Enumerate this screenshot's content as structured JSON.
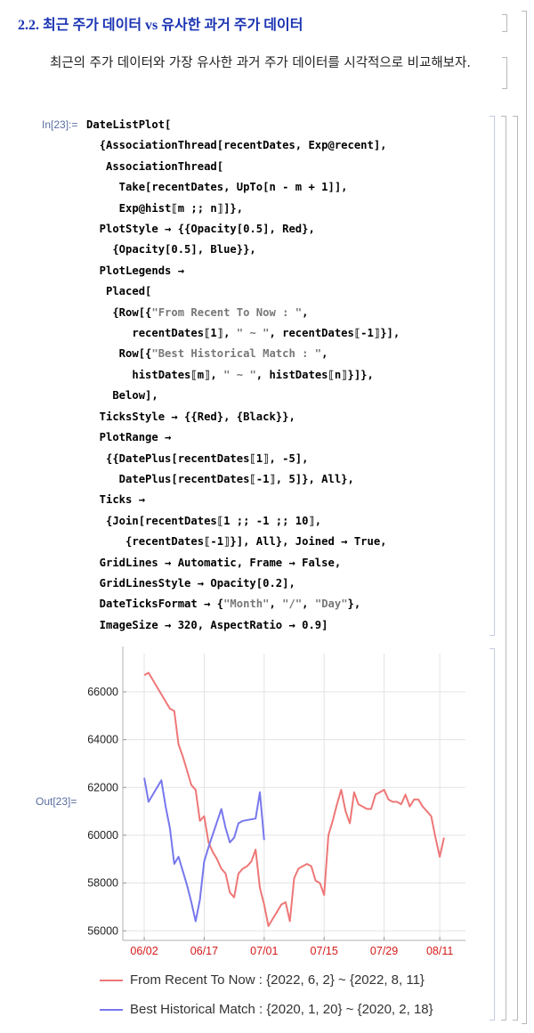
{
  "section": {
    "title": "2.2. 최근 주가 데이터 vs 유사한 과거 주가 데이터"
  },
  "text_cell": {
    "text": "최근의 주가 데이터와 가장 유사한 과거 주가 데이터를 시각적으로 비교해보자."
  },
  "input": {
    "label": "In[23]:=",
    "code_lines": [
      "DateListPlot[",
      "  {AssociationThread[recentDates, Exp@recent],",
      "   AssociationThread[",
      "     Take[recentDates, UpTo[n - m + 1]],",
      "     Exp@hist⟦m ;; n⟧]},",
      "  PlotStyle → {{Opacity[0.5], Red},",
      "    {Opacity[0.5], Blue}},",
      "  PlotLegends →",
      "   Placed[",
      "    {Row[{\"From Recent To Now : \",",
      "       recentDates⟦1⟧, \" ~ \", recentDates⟦-1⟧}],",
      "     Row[{\"Best Historical Match : \",",
      "       histDates⟦m⟧, \" ~ \", histDates⟦n⟧}]},",
      "    Below],",
      "  TicksStyle → {{Red}, {Black}},",
      "  PlotRange →",
      "   {{DatePlus[recentDates⟦1⟧, -5],",
      "     DatePlus[recentDates⟦-1⟧, 5]}, All},",
      "  Ticks →",
      "   {Join[recentDates⟦1 ;; -1 ;; 10⟧,",
      "      {recentDates⟦-1⟧}], All}, Joined → True,",
      "  GridLines → Automatic, Frame → False,",
      "  GridLinesStyle → Opacity[0.2],",
      "  DateTicksFormat → {\"Month\", \"/\", \"Day\"},",
      "  ImageSize → 320, AspectRatio → 0.9]"
    ]
  },
  "output": {
    "label": "Out[23]="
  },
  "chart_data": {
    "type": "line",
    "title": "",
    "xlabel": "",
    "ylabel": "",
    "x_tick_labels": [
      "06/02",
      "06/17",
      "07/01",
      "07/15",
      "07/29",
      "08/11"
    ],
    "y_ticks": [
      56000,
      58000,
      60000,
      62000,
      64000,
      66000
    ],
    "y_tick_labels": [
      "56000",
      "58000",
      "60000",
      "62000",
      "64000",
      "66000"
    ],
    "xlim": [
      -5,
      75
    ],
    "ylim": [
      55600,
      67600
    ],
    "grid": true,
    "legend_position": "below",
    "x_tick_color": "#d61a1a",
    "y_tick_color": "#222222",
    "series": [
      {
        "name": "From Recent To Now : {2022, 6, 2} ~ {2022, 8, 11}",
        "color": "#ee7777",
        "x": [
          0,
          1,
          2,
          3,
          4,
          5,
          6,
          7,
          8,
          9,
          10,
          11,
          12,
          13,
          14,
          15,
          16,
          17,
          18,
          19,
          20,
          21,
          22,
          23,
          24,
          25,
          26,
          27,
          28,
          29,
          30,
          31,
          32,
          33,
          34,
          35,
          36,
          37,
          38,
          39,
          40,
          41,
          42,
          43,
          44,
          45,
          46,
          47,
          48,
          49,
          50,
          51,
          52,
          53,
          54,
          55,
          56,
          57,
          58,
          59,
          60,
          61,
          62,
          63,
          64,
          65,
          66,
          67,
          68,
          69,
          70
        ],
        "values": [
          66700,
          66800,
          66500,
          66200,
          65900,
          65600,
          65300,
          65200,
          63800,
          63300,
          62700,
          62100,
          61900,
          60600,
          60800,
          59700,
          59300,
          59000,
          58600,
          58400,
          57600,
          57400,
          58400,
          58600,
          58700,
          58900,
          59400,
          57800,
          57100,
          56200,
          56500,
          56800,
          57100,
          57200,
          56400,
          58200,
          58600,
          58700,
          58800,
          58700,
          58100,
          58000,
          57500,
          60000,
          60600,
          61300,
          61900,
          61000,
          60500,
          61800,
          61300,
          61200,
          61100,
          61100,
          61700,
          61800,
          61900,
          61500,
          61400,
          61400,
          61300,
          61700,
          61200,
          61500,
          61500,
          61200,
          61000,
          60800,
          59900,
          59100,
          59900
        ]
      },
      {
        "name": "Best Historical Match : {2020, 1, 20} ~ {2020, 2, 18}",
        "color": "#7777ee",
        "x": [
          0,
          1,
          4,
          5,
          6,
          7,
          8,
          9,
          10,
          11,
          12,
          13,
          14,
          15,
          18,
          19,
          20,
          21,
          22,
          23,
          26,
          27,
          28
        ],
        "values": [
          62400,
          61400,
          62300,
          61200,
          60300,
          58800,
          59100,
          58500,
          57900,
          57200,
          56400,
          57300,
          58900,
          59500,
          61100,
          60300,
          59700,
          59900,
          60500,
          60600,
          60700,
          61800,
          59800
        ]
      }
    ]
  }
}
